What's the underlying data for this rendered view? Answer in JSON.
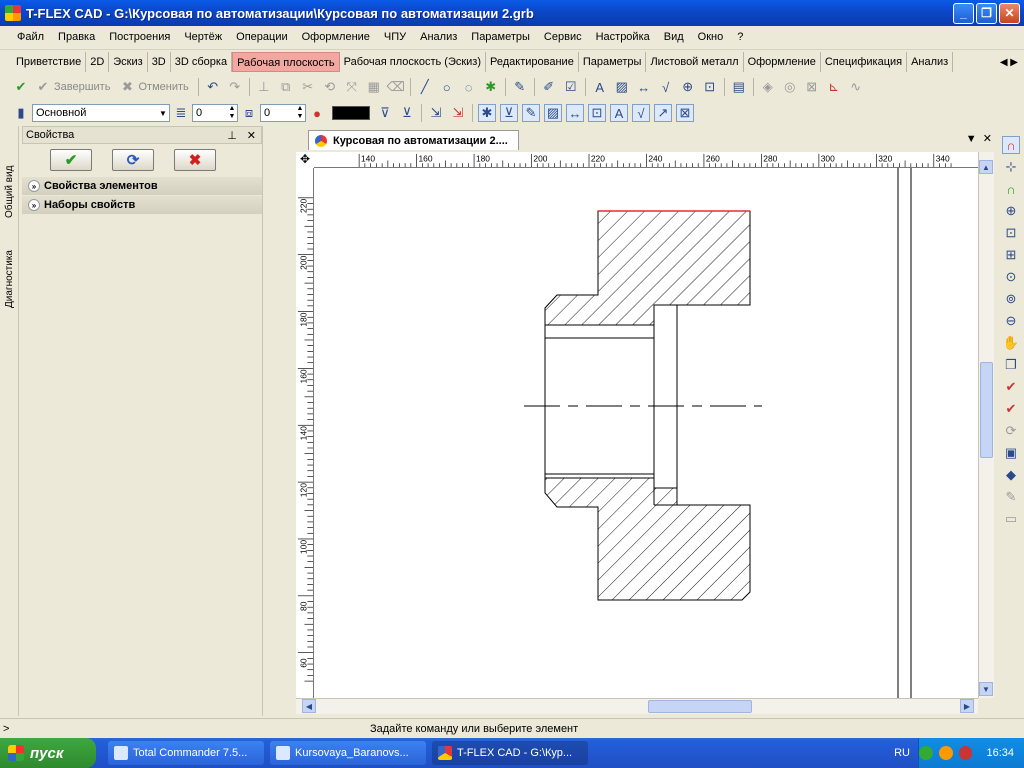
{
  "window": {
    "title": "T-FLEX CAD - G:\\Курсовая по автоматизации\\Курсовая по автоматизации 2.grb"
  },
  "menu": [
    "Файл",
    "Правка",
    "Построения",
    "Чертёж",
    "Операции",
    "Оформление",
    "ЧПУ",
    "Анализ",
    "Параметры",
    "Сервис",
    "Настройка",
    "Вид",
    "Окно",
    "?"
  ],
  "ribbon_tabs": [
    {
      "label": "Приветствие",
      "active": false
    },
    {
      "label": "2D",
      "active": false
    },
    {
      "label": "Эскиз",
      "active": false
    },
    {
      "label": "3D",
      "active": false
    },
    {
      "label": "3D сборка",
      "active": false
    },
    {
      "label": "Рабочая плоскость",
      "active": true
    },
    {
      "label": "Рабочая плоскость (Эскиз)",
      "active": false
    },
    {
      "label": "Редактирование",
      "active": false
    },
    {
      "label": "Параметры",
      "active": false
    },
    {
      "label": "Листовой металл",
      "active": false
    },
    {
      "label": "Оформление",
      "active": false
    },
    {
      "label": "Спецификация",
      "active": false
    },
    {
      "label": "Анализ",
      "active": false
    }
  ],
  "toolbar1": {
    "finish_label": "Завершить",
    "cancel_label": "Отменить"
  },
  "toolbar2": {
    "style_value": "Основной",
    "layer_value": "0",
    "level_value": "0",
    "line_color": "#000000"
  },
  "properties_panel": {
    "title": "Свойства",
    "section_elements": "Свойства элементов",
    "section_sets": "Наборы свойств"
  },
  "side_tabs": [
    "Общий вид",
    "Диагностика"
  ],
  "document": {
    "tab_title": "Курсовая по автоматизации 2...."
  },
  "ruler": {
    "top_ticks": [
      "140",
      "160",
      "180",
      "200",
      "220",
      "240",
      "260",
      "280",
      "300",
      "320",
      "340"
    ],
    "left_ticks": [
      "220",
      "200",
      "180",
      "160",
      "140",
      "120",
      "100",
      "80",
      "60"
    ]
  },
  "status": {
    "prompt": ">",
    "message": "Задайте команду или выберите элемент"
  },
  "taskbar": {
    "start_label": "пуск",
    "tasks": [
      {
        "label": "Total Commander 7.5...",
        "active": false
      },
      {
        "label": "Kursovaya_Baranovs...",
        "active": false
      },
      {
        "label": "T-FLEX CAD - G:\\Кур...",
        "active": true
      }
    ],
    "language": "RU",
    "clock": "16:34"
  }
}
